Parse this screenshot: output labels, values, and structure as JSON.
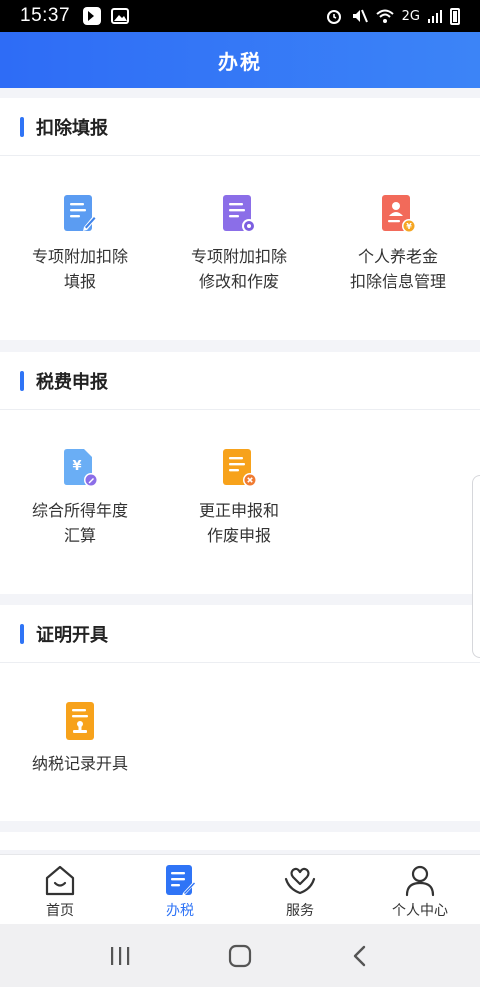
{
  "status_bar": {
    "time": "15:37",
    "network": "2G"
  },
  "header": {
    "title": "办税"
  },
  "sections": [
    {
      "title": "扣除填报",
      "items": [
        {
          "line1": "专项附加扣除",
          "line2": "填报",
          "icon": "doc-edit-icon"
        },
        {
          "line1": "专项附加扣除",
          "line2": "修改和作废",
          "icon": "doc-settings-icon"
        },
        {
          "line1": "个人养老金",
          "line2": "扣除信息管理",
          "icon": "pension-card-icon"
        }
      ]
    },
    {
      "title": "税费申报",
      "items": [
        {
          "line1": "综合所得年度",
          "line2": "汇算",
          "icon": "yuan-doc-icon"
        },
        {
          "line1": "更正申报和",
          "line2": "作废申报",
          "icon": "doc-cancel-icon"
        }
      ]
    },
    {
      "title": "证明开具",
      "items": [
        {
          "line1": "纳税记录开具",
          "line2": "",
          "icon": "stamp-doc-icon"
        }
      ]
    }
  ],
  "bottom_nav": [
    {
      "label": "首页",
      "icon": "home-icon",
      "active": false
    },
    {
      "label": "办税",
      "icon": "tax-doc-icon",
      "active": true
    },
    {
      "label": "服务",
      "icon": "service-heart-icon",
      "active": false
    },
    {
      "label": "个人中心",
      "icon": "person-icon",
      "active": false
    }
  ],
  "colors": {
    "accent": "#2f74f6",
    "header_gradient_start": "#2e6cf6",
    "header_gradient_end": "#3c84f7"
  }
}
